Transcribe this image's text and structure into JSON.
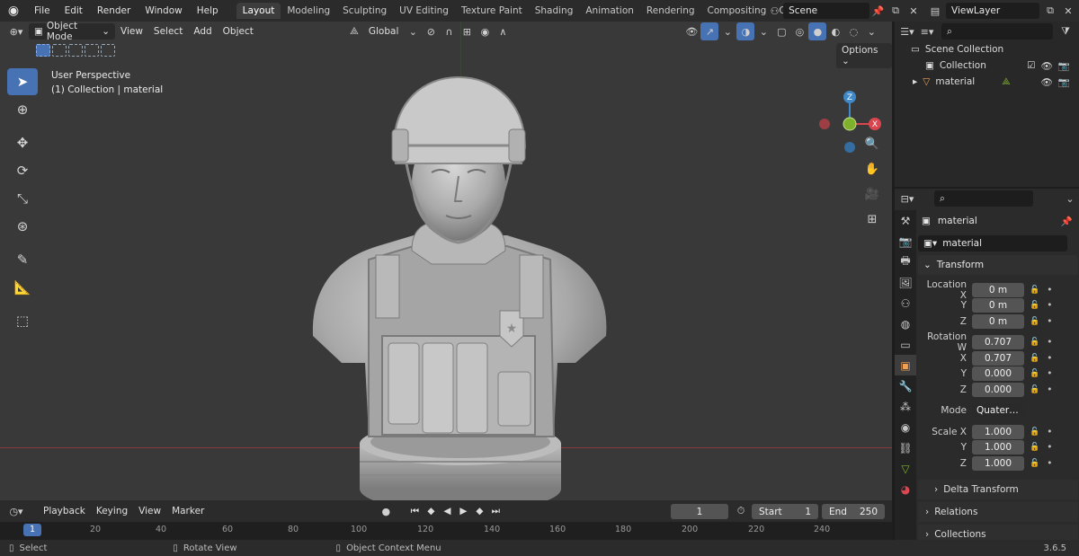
{
  "app": {
    "logo_icon": "blender-logo"
  },
  "menu": [
    "File",
    "Edit",
    "Render",
    "Window",
    "Help"
  ],
  "workspace_tabs": [
    {
      "label": "Layout",
      "active": true
    },
    {
      "label": "Modeling"
    },
    {
      "label": "Sculpting"
    },
    {
      "label": "UV Editing"
    },
    {
      "label": "Texture Paint"
    },
    {
      "label": "Shading"
    },
    {
      "label": "Animation"
    },
    {
      "label": "Rendering"
    },
    {
      "label": "Compositing"
    },
    {
      "label": "Geometry Noc"
    }
  ],
  "scene": {
    "name": "Scene"
  },
  "view_layer": {
    "name": "ViewLayer"
  },
  "viewport": {
    "mode": "Object Mode",
    "menus": [
      "View",
      "Select",
      "Add",
      "Object"
    ],
    "orientation": "Global",
    "options_label": "Options",
    "info_line1": "User Perspective",
    "info_line2": "(1) Collection | material",
    "gizmo": {
      "z": "Z",
      "y": "Y",
      "x": "X"
    }
  },
  "timeline": {
    "menus": [
      "Playback",
      "Keying",
      "View",
      "Marker"
    ],
    "current_frame": "1",
    "start_label": "Start",
    "start": "1",
    "end_label": "End",
    "end": "250",
    "ruler_cursor": "1",
    "ruler": [
      "20",
      "40",
      "60",
      "80",
      "100",
      "120",
      "140",
      "160",
      "180",
      "200",
      "220",
      "240"
    ]
  },
  "status": {
    "select": "Select",
    "rotate": "Rotate View",
    "context": "Object Context Menu",
    "version": "3.6.5"
  },
  "outliner": {
    "root": "Scene Collection",
    "items": [
      {
        "label": "Collection"
      },
      {
        "label": "material"
      }
    ]
  },
  "properties": {
    "object_name": "material",
    "datablock_name": "material",
    "transform_title": "Transform",
    "location_label": "Location X",
    "location": [
      "0 m",
      "0 m",
      "0 m"
    ],
    "rotation_label": "Rotation W",
    "rotation": [
      "0.707",
      "0.707",
      "0.000",
      "0.000"
    ],
    "mode_label": "Mode",
    "mode_value": "Quater…",
    "scale_label": "Scale X",
    "scale": [
      "1.000",
      "1.000",
      "1.000"
    ],
    "axis": {
      "x": "X",
      "y": "Y",
      "z": "Z"
    },
    "delta_transform": "Delta Transform",
    "relations": "Relations",
    "collections": "Collections"
  },
  "colors": {
    "accent": "#4772b3",
    "viewport_bg": "#393939",
    "x_axis": "#d9464f",
    "y_axis": "#7fb22c",
    "z_axis": "#3f88c9"
  }
}
